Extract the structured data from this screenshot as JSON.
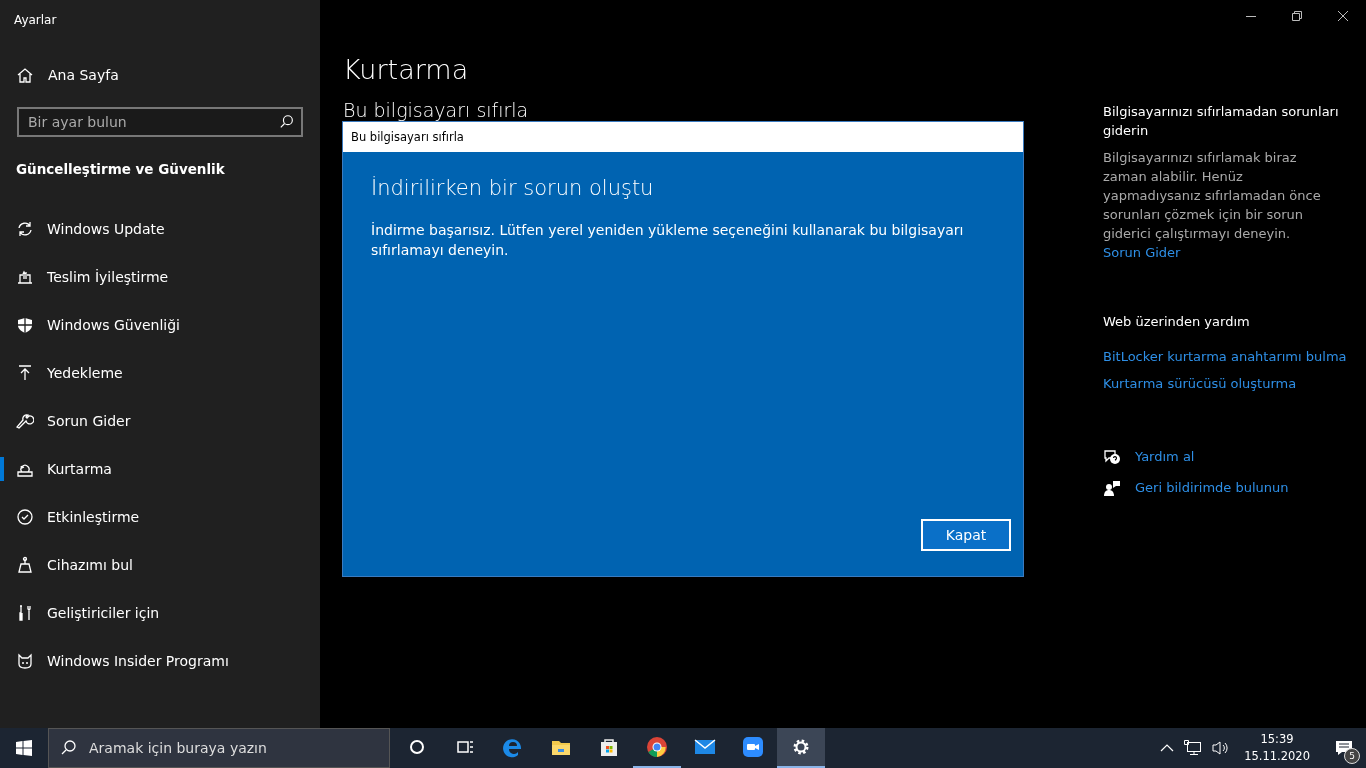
{
  "window": {
    "title": "Ayarlar"
  },
  "sidebar": {
    "home": "Ana Sayfa",
    "search": {
      "placeholder": "Bir ayar bulun"
    },
    "section": "Güncelleştirme ve Güvenlik",
    "items": [
      {
        "kind": "update",
        "label": "Windows Update",
        "selected": false
      },
      {
        "kind": "delivery",
        "label": "Teslim İyileştirme",
        "selected": false
      },
      {
        "kind": "shield",
        "label": "Windows Güvenliği",
        "selected": false
      },
      {
        "kind": "backup",
        "label": "Yedekleme",
        "selected": false
      },
      {
        "kind": "wrench",
        "label": "Sorun Gider",
        "selected": false
      },
      {
        "kind": "recovery",
        "label": "Kurtarma",
        "selected": true
      },
      {
        "kind": "check",
        "label": "Etkinleştirme",
        "selected": false
      },
      {
        "kind": "find",
        "label": "Cihazımı bul",
        "selected": false
      },
      {
        "kind": "dev",
        "label": "Geliştiriciler için",
        "selected": false
      },
      {
        "kind": "insider",
        "label": "Windows Insider Programı",
        "selected": false
      }
    ]
  },
  "main": {
    "title": "Kurtarma",
    "subtitle": "Bu bilgisayarı sıfırla"
  },
  "dialog": {
    "title": "Bu bilgisayarı sıfırla",
    "heading": "İndirilirken bir sorun oluştu",
    "message": "İndirme başarısız. Lütfen yerel yeniden yükleme seçeneğini kullanarak bu bilgisayarı sıfırlamayı deneyin.",
    "button": "Kapat"
  },
  "help": {
    "troubleshoot_title": "Bilgisayarınızı sıfırlamadan sorunları giderin",
    "troubleshoot_text": "Bilgisayarınızı sıfırlamak biraz zaman alabilir. Henüz yapmadıysanız sıfırlamadan önce sorunları çözmek için bir sorun giderici çalıştırmayı deneyin.",
    "troubleshoot_link": "Sorun Gider",
    "web_title": "Web üzerinden yardım",
    "web_links": [
      "BitLocker kurtarma anahtarımı bulma",
      "Kurtarma sürücüsü oluşturma"
    ],
    "actions": [
      {
        "kind": "help",
        "label": "Yardım al"
      },
      {
        "kind": "feedback",
        "label": "Geri bildirimde bulunun"
      }
    ]
  },
  "taskbar": {
    "search": {
      "placeholder": "Aramak için buraya yazın"
    },
    "apps": [
      {
        "kind": "cortana",
        "running": false,
        "selected": false
      },
      {
        "kind": "taskview",
        "running": false,
        "selected": false
      },
      {
        "kind": "edge",
        "running": false,
        "selected": false
      },
      {
        "kind": "explorer",
        "running": false,
        "selected": false
      },
      {
        "kind": "store",
        "running": false,
        "selected": false
      },
      {
        "kind": "chrome",
        "running": true,
        "selected": false
      },
      {
        "kind": "mail",
        "running": false,
        "selected": false
      },
      {
        "kind": "zoom",
        "running": false,
        "selected": false
      },
      {
        "kind": "settings",
        "running": true,
        "selected": true
      }
    ],
    "time": "15:39",
    "date": "15.11.2020",
    "notifications": "5"
  }
}
